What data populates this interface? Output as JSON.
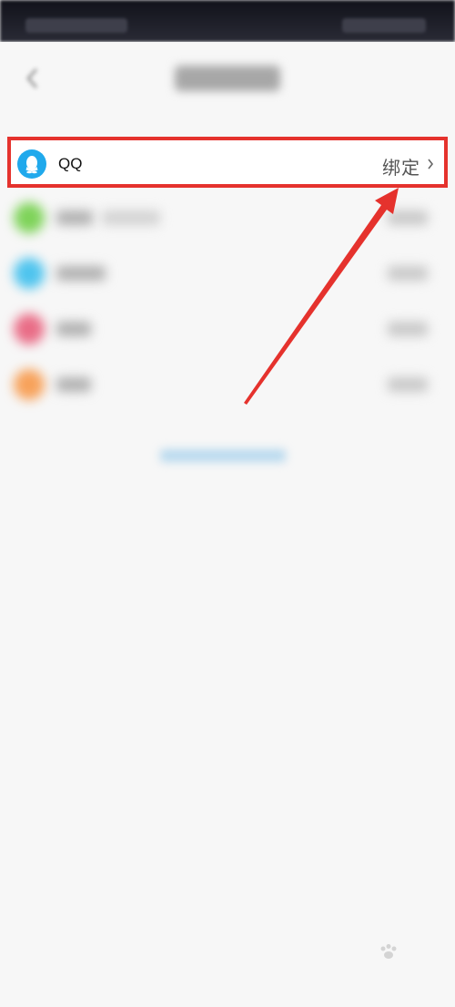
{
  "colors": {
    "highlight": "#e5322d",
    "qq_brand": "#20a9ec",
    "wechat": "#7fd35a",
    "icon_blue": "#4fc4ee",
    "icon_pink": "#e96d87",
    "icon_orange": "#f7a25b"
  },
  "header": {
    "back_icon": "chevron-left-icon"
  },
  "accounts": [
    {
      "label": "QQ",
      "status": "绑定",
      "icon": "qq-penguin-icon",
      "highlighted": true
    }
  ],
  "watermark": {
    "icon": "baidu-paw-icon"
  }
}
